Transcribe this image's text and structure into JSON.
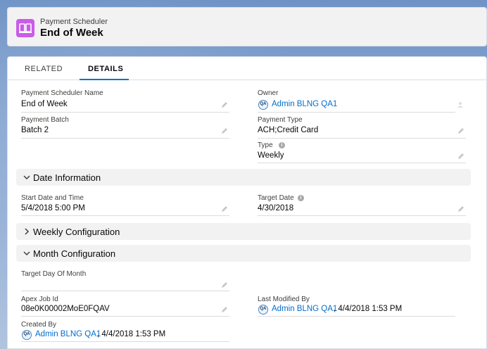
{
  "header": {
    "object_label": "Payment Scheduler",
    "record_name": "End of Week"
  },
  "tabs": [
    {
      "label": "RELATED"
    },
    {
      "label": "DETAILS"
    }
  ],
  "fields": {
    "scheduler_name": {
      "label": "Payment Scheduler Name",
      "value": "End of Week"
    },
    "owner": {
      "label": "Owner",
      "value": "Admin BLNG QA1",
      "avatar": "QA"
    },
    "payment_batch": {
      "label": "Payment Batch",
      "value": "Batch 2"
    },
    "payment_type": {
      "label": "Payment Type",
      "value": "ACH;Credit Card"
    },
    "type": {
      "label": "Type",
      "value": "Weekly"
    },
    "start_date": {
      "label": "Start Date and Time",
      "value": "5/4/2018 5:00 PM"
    },
    "target_date": {
      "label": "Target Date",
      "value": "4/30/2018"
    },
    "target_day": {
      "label": "Target Day Of Month",
      "value": ""
    },
    "apex_job": {
      "label": "Apex Job Id",
      "value": "08e0K00002MoE0FQAV"
    },
    "last_modified": {
      "label": "Last Modified By",
      "user": "Admin BLNG QA1",
      "avatar": "QA",
      "date": ", 4/4/2018 1:53 PM"
    },
    "created_by": {
      "label": "Created By",
      "user": "Admin BLNG QA1",
      "avatar": "QA",
      "date": ", 4/4/2018 1:53 PM"
    }
  },
  "sections": {
    "date_info": "Date Information",
    "weekly": "Weekly Configuration",
    "month": "Month Configuration"
  },
  "colors": {
    "accent": "#0070d2",
    "link": "#006dcc",
    "record_icon": "#c95ce8"
  }
}
